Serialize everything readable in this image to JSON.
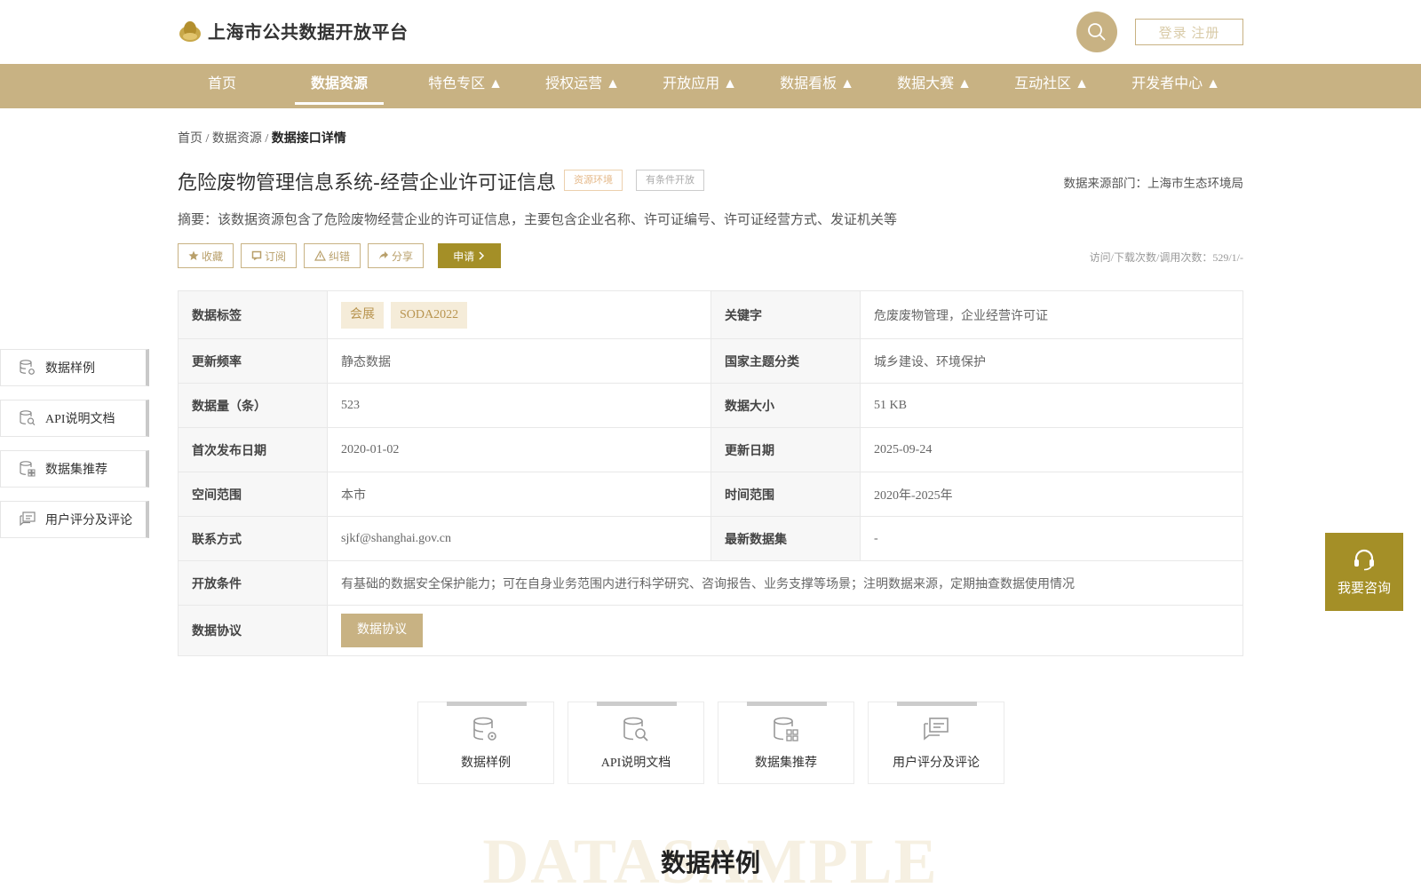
{
  "header": {
    "site_title": "上海市公共数据开放平台",
    "login_label": "登录 注册"
  },
  "nav": [
    {
      "label": "首页"
    },
    {
      "label": "数据资源"
    },
    {
      "label": "特色专区 ▲"
    },
    {
      "label": "授权运营 ▲"
    },
    {
      "label": "开放应用 ▲"
    },
    {
      "label": "数据看板 ▲"
    },
    {
      "label": "数据大赛 ▲"
    },
    {
      "label": "互动社区 ▲"
    },
    {
      "label": "开发者中心 ▲"
    }
  ],
  "breadcrumb": {
    "home": "首页",
    "resources": "数据资源",
    "current": "数据接口详情",
    "sep": " / "
  },
  "detail": {
    "title": "危险废物管理信息系统-经营企业许可证信息",
    "badge_env": "资源环境",
    "badge_open": "有条件开放",
    "source": "数据来源部门：上海市生态环境局",
    "summary": "摘要：该数据资源包含了危险废物经营企业的许可证信息，主要包含企业名称、许可证编号、许可证经营方式、发证机关等",
    "actions": {
      "collect": "收藏",
      "subscribe": "订阅",
      "report": "纠错",
      "share": "分享",
      "apply": "申请"
    },
    "stats": "访问/下载次数/调用次数：529/1/-"
  },
  "table": {
    "tags_label": "数据标签",
    "tags": [
      "会展",
      "SODA2022"
    ],
    "keywords_label": "关键字",
    "keywords": "危废废物管理，企业经营许可证",
    "freq_label": "更新频率",
    "freq": "静态数据",
    "theme_label": "国家主题分类",
    "theme": "城乡建设、环境保护",
    "count_label": "数据量（条）",
    "count": "523",
    "size_label": "数据大小",
    "size": "51 KB",
    "first_date_label": "首次发布日期",
    "first_date": "2020-01-02",
    "update_date_label": "更新日期",
    "update_date": "2025-09-24",
    "space_label": "空间范围",
    "space": "本市",
    "time_label": "时间范围",
    "time": "2020年-2025年",
    "contact_label": "联系方式",
    "contact": "sjkf@shanghai.gov.cn",
    "latest_label": "最新数据集",
    "latest": "-",
    "condition_label": "开放条件",
    "condition": "有基础的数据安全保护能力；可在自身业务范围内进行科学研究、咨询报告、业务支撑等场景；注明数据来源，定期抽查数据使用情况",
    "agreement_label": "数据协议",
    "agreement_btn": "数据协议"
  },
  "sidenav": [
    {
      "label": "数据样例",
      "icon": "database-gear-icon"
    },
    {
      "label": "API说明文档",
      "icon": "doc-search-icon"
    },
    {
      "label": "数据集推荐",
      "icon": "database-grid-icon"
    },
    {
      "label": "用户评分及评论",
      "icon": "comment-icon"
    }
  ],
  "consult": "我要咨询",
  "cards": [
    {
      "label": "数据样例"
    },
    {
      "label": "API说明文档"
    },
    {
      "label": "数据集推荐"
    },
    {
      "label": "用户评分及评论"
    }
  ],
  "section": {
    "bg_text": "DATASAMPLE",
    "title": "数据样例"
  },
  "colors": {
    "brand": "#c8b283",
    "accent_dark": "#a48f27"
  }
}
